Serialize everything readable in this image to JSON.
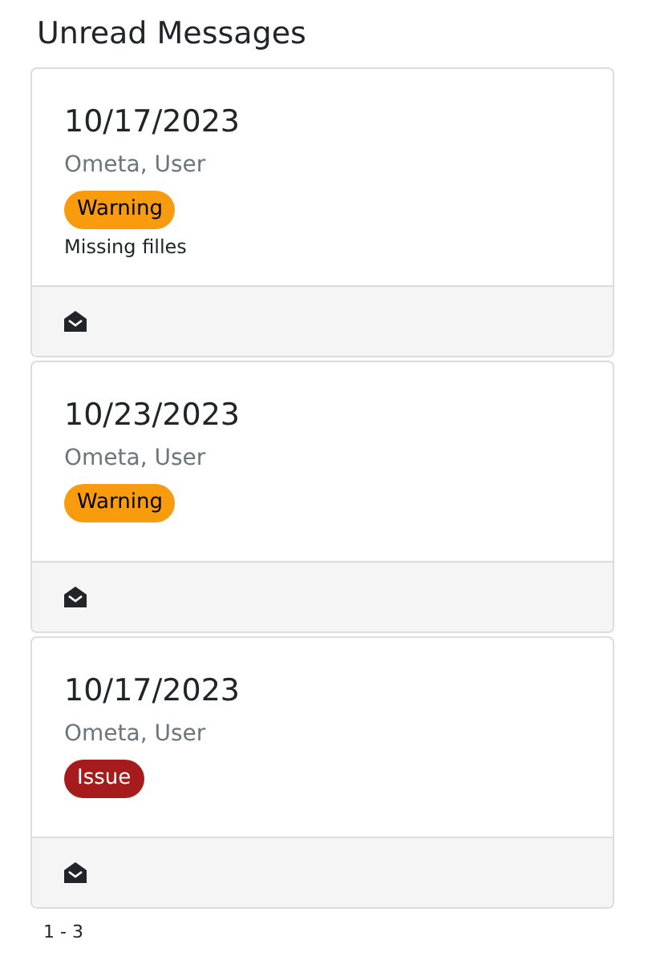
{
  "title": "Unread Messages",
  "messages": [
    {
      "date": "10/17/2023",
      "sender": "Ometa, User",
      "badge": {
        "label": "Warning",
        "kind": "warning"
      },
      "text": "Missing filles"
    },
    {
      "date": "10/23/2023",
      "sender": "Ometa, User",
      "badge": {
        "label": "Warning",
        "kind": "warning"
      }
    },
    {
      "date": "10/17/2023",
      "sender": "Ometa, User",
      "badge": {
        "label": "Issue",
        "kind": "issue"
      }
    }
  ],
  "pagination": "1 - 3"
}
